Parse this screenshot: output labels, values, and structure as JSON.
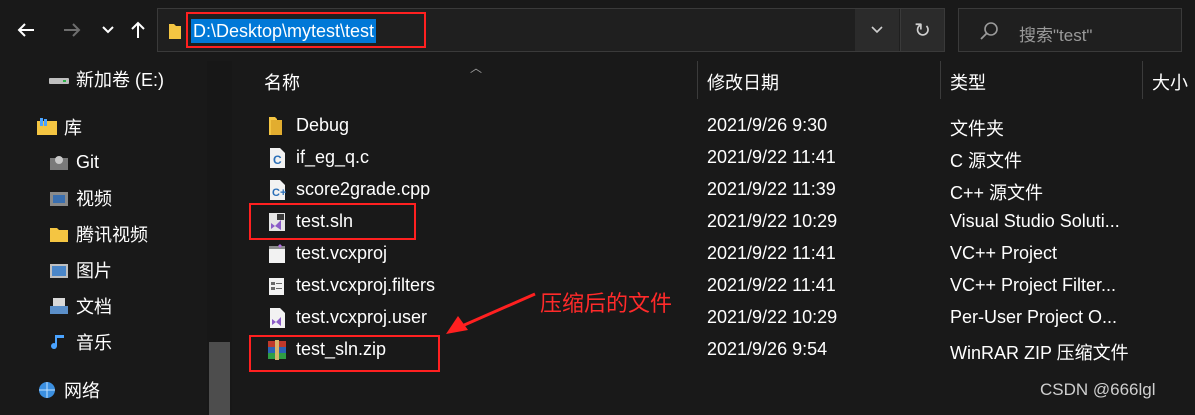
{
  "toolbar": {
    "back_icon": "back-arrow-icon",
    "forward_icon": "forward-arrow-icon",
    "recent_icon": "chevron-down-icon",
    "up_icon": "up-arrow-icon"
  },
  "address": {
    "path": "D:\\Desktop\\mytest\\test",
    "dropdown_glyph": "⌄",
    "refresh_glyph": "↻"
  },
  "search": {
    "placeholder": "搜索\"test\""
  },
  "sidebar": {
    "items": [
      {
        "label": "新加卷 (E:)",
        "icon": "drive-icon"
      },
      {
        "label": "库",
        "icon": "library-icon"
      },
      {
        "label": "Git",
        "icon": "git-library-icon"
      },
      {
        "label": "视频",
        "icon": "videos-icon"
      },
      {
        "label": "腾讯视频",
        "icon": "tencent-video-icon"
      },
      {
        "label": "图片",
        "icon": "pictures-icon"
      },
      {
        "label": "文档",
        "icon": "documents-icon"
      },
      {
        "label": "音乐",
        "icon": "music-icon"
      },
      {
        "label": "网络",
        "icon": "network-icon"
      }
    ]
  },
  "columns": {
    "name": "名称",
    "date": "修改日期",
    "type": "类型",
    "size": "大小"
  },
  "files": [
    {
      "name": "Debug",
      "date": "2021/9/26 9:30",
      "type": "文件夹",
      "icon": "folder-icon"
    },
    {
      "name": "if_eg_q.c",
      "date": "2021/9/22 11:41",
      "type": "C 源文件",
      "icon": "c-file-icon"
    },
    {
      "name": "score2grade.cpp",
      "date": "2021/9/22 11:39",
      "type": "C++ 源文件",
      "icon": "cpp-file-icon"
    },
    {
      "name": "test.sln",
      "date": "2021/9/22 10:29",
      "type": "Visual Studio Soluti...",
      "icon": "vs-solution-icon"
    },
    {
      "name": "test.vcxproj",
      "date": "2021/9/22 11:41",
      "type": "VC++ Project",
      "icon": "vcxproj-icon"
    },
    {
      "name": "test.vcxproj.filters",
      "date": "2021/9/22 11:41",
      "type": "VC++ Project Filter...",
      "icon": "filters-file-icon"
    },
    {
      "name": "test.vcxproj.user",
      "date": "2021/9/22 10:29",
      "type": "Per-User Project O...",
      "icon": "user-file-icon"
    },
    {
      "name": "test_sln.zip",
      "date": "2021/9/26 9:54",
      "type": "WinRAR ZIP 压缩文件",
      "icon": "winrar-zip-icon"
    }
  ],
  "annotation": {
    "text": "压缩后的文件",
    "color": "#ff2020"
  },
  "watermark": "CSDN @666lgl",
  "colors": {
    "background": "#191919",
    "selection": "#0078d7",
    "annotation_red": "#ff2020",
    "folder_yellow": "#f4c542"
  }
}
